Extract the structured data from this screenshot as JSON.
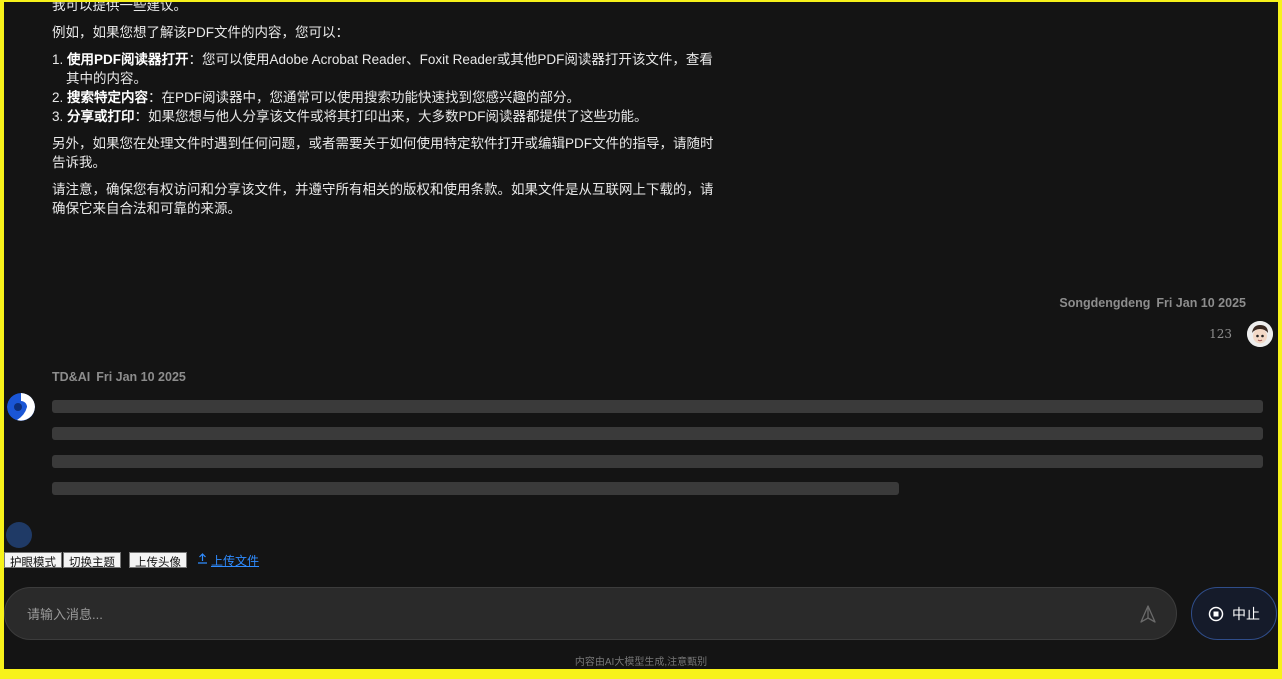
{
  "previous_ai_message": {
    "line_top": "我可以提供一些建议。",
    "para_intro": "例如，如果您想了解该PDF文件的内容，您可以：",
    "list": [
      {
        "num": "1.",
        "bold": "使用PDF阅读器打开",
        "text": "：您可以使用Adobe Acrobat Reader、Foxit Reader或其他PDF阅读器打开该文件，查看其中的内容。"
      },
      {
        "num": "2.",
        "bold": "搜索特定内容",
        "text": "：在PDF阅读器中，您通常可以使用搜索功能快速找到您感兴趣的部分。"
      },
      {
        "num": "3.",
        "bold": "分享或打印",
        "text": "：如果您想与他人分享该文件或将其打印出来，大多数PDF阅读器都提供了这些功能。"
      }
    ],
    "para_help": "另外，如果您在处理文件时遇到任何问题，或者需要关于如何使用特定软件打开或编辑PDF文件的指导，请随时告诉我。",
    "para_note": "请注意，确保您有权访问和分享该文件，并遵守所有相关的版权和使用条款。如果文件是从互联网上下载的，请确保它来自合法和可靠的来源。"
  },
  "user_message": {
    "author": "Songdengdeng",
    "date": "Fri Jan 10 2025",
    "text": "123",
    "avatar_icon": "user-avatar-icon"
  },
  "ai_message": {
    "author": "TD&AI",
    "date": "Fri Jan 10 2025",
    "state": "loading",
    "avatar_icon": "ai-avatar-icon"
  },
  "toolbar": {
    "eye_mode": "护眼模式",
    "switch_theme": "切换主题",
    "upload_avatar": "上传头像",
    "upload_file": "上传文件",
    "upload_icon": "upload-arrow-icon"
  },
  "input": {
    "placeholder": "请输入消息...",
    "value": ""
  },
  "stop_button": {
    "label": "中止"
  },
  "disclaimer": "内容由AI大模型生成,注意甄别",
  "colors": {
    "page_bg": "#141414",
    "frame_border": "#f7f21a",
    "accent": "#2f8cff",
    "skeleton": "#3a3a3a"
  }
}
